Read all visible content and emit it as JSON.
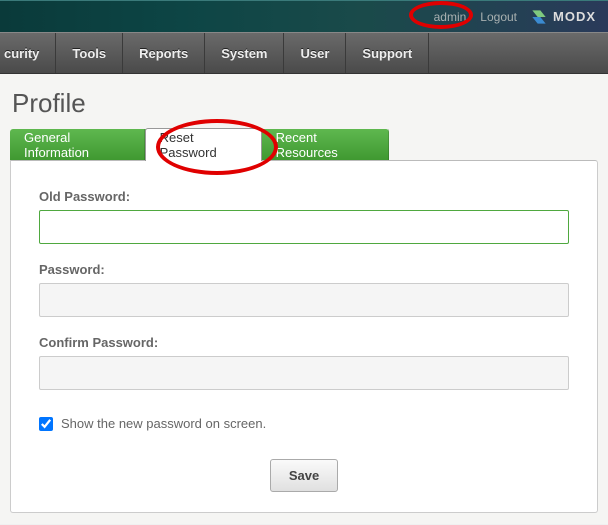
{
  "header": {
    "user": "admin",
    "logout": "Logout",
    "brand": "MODX"
  },
  "menu": {
    "items": [
      "curity",
      "Tools",
      "Reports",
      "System",
      "User",
      "Support"
    ]
  },
  "page": {
    "title": "Profile"
  },
  "tabs": {
    "items": [
      {
        "label": "General Information",
        "active": false
      },
      {
        "label": "Reset Password",
        "active": true
      },
      {
        "label": "Recent Resources",
        "active": false
      }
    ]
  },
  "form": {
    "old_password_label": "Old Password:",
    "old_password_value": "",
    "password_label": "Password:",
    "password_value": "",
    "confirm_label": "Confirm Password:",
    "confirm_value": "",
    "show_password_label": "Show the new password on screen.",
    "show_password_checked": true,
    "save_label": "Save"
  }
}
